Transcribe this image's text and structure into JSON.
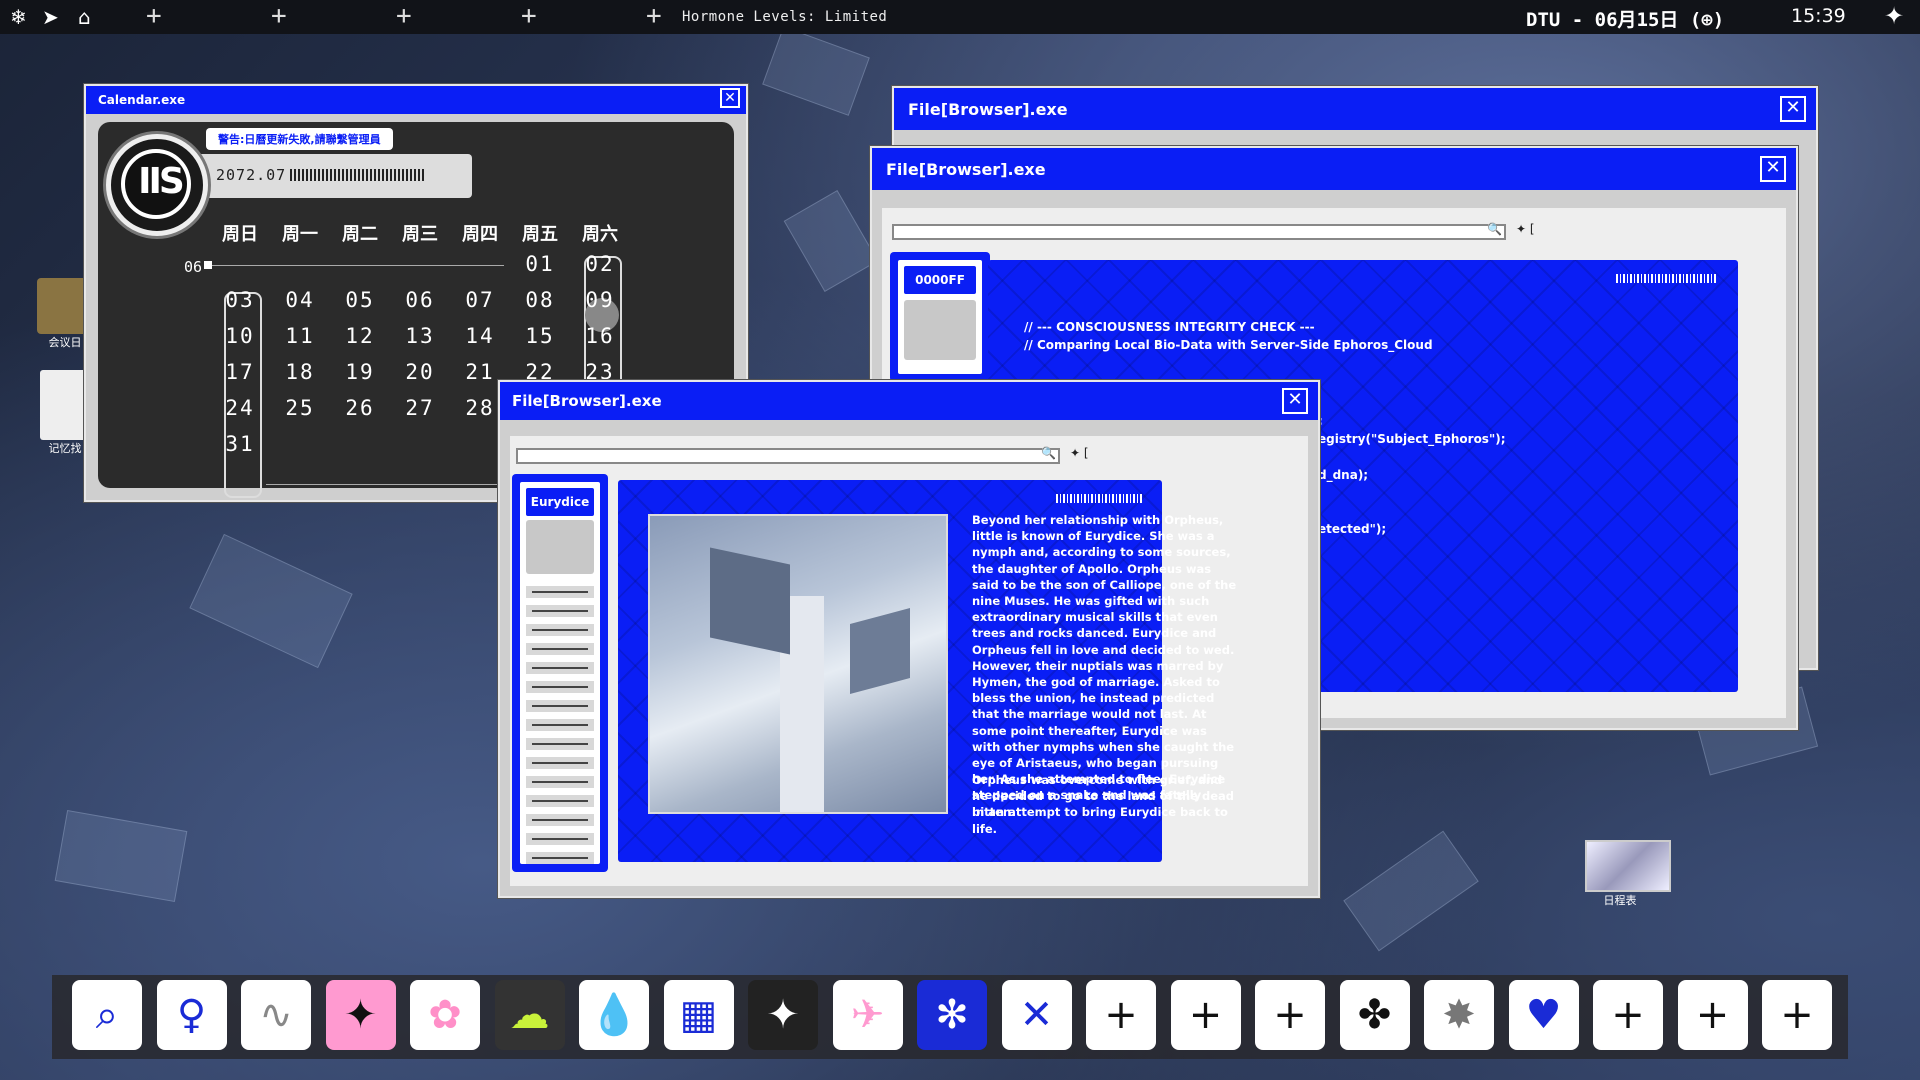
{
  "topbar": {
    "status": "Hormone Levels: Limited",
    "date": "DTU - 06月15日 (⊕)",
    "time": "15:39"
  },
  "calendar": {
    "title": "Calendar.exe",
    "warning": "警告:日曆更新失敗,請聯繫管理員",
    "year_month": "2072.07",
    "month_label": "06",
    "weekdays": [
      "周日",
      "周一",
      "周二",
      "周三",
      "周四",
      "周五",
      "周六"
    ],
    "rows": [
      [
        "",
        "",
        "",
        "",
        "",
        "01",
        "02"
      ],
      [
        "03",
        "04",
        "05",
        "06",
        "07",
        "08",
        "09"
      ],
      [
        "10",
        "11",
        "12",
        "13",
        "14",
        "15",
        "16"
      ],
      [
        "17",
        "18",
        "19",
        "20",
        "21",
        "22",
        "23"
      ],
      [
        "24",
        "25",
        "26",
        "27",
        "28",
        "",
        ""
      ],
      [
        "31",
        "",
        "",
        "",
        "",
        "",
        ""
      ]
    ],
    "selected_day": "09"
  },
  "browser_back": {
    "title": "File[Browser].exe"
  },
  "browser_mid": {
    "title": "File[Browser].exe",
    "sidebar_tag": "0000FF",
    "code_lines": [
      "// --- CONSCIOUSNESS INTEGRITY CHECK ---",
      "// Comparing Local Bio-Data with Server-Side Ephoros_Cloud"
    ],
    "code_fragments": [
      ";",
      "egistry(\"Subject_Ephoros\");",
      "d_dna);",
      "etected\");"
    ]
  },
  "browser_front": {
    "title": "File[Browser].exe",
    "sidebar_tag": "Eurydice",
    "search_extra": "✦ [",
    "text": "Beyond her relationship with Orpheus, little is known of Eurydice. She was a nymph and, according to some sources, the daughter of Apollo. Orpheus was said to be the son of Calliope, one of the nine Muses. He was gifted with such extraordinary musical skills that even trees and rocks danced. Eurydice and Orpheus fell in love and decided to wed. However, their nuptials was marred by Hymen, the god of marriage. Asked to bless the union, he instead predicted that the marriage would not last. At some point thereafter, Eurydice was with other nymphs when she caught the eye of Aristaeus, who began pursuing her. As she attempted to flee, Eurydice stepped on a snake and was fatally bitten.",
    "text2": "Orpheus was overcome with grief, and he decided to go to the land of the dead in an attempt to bring Eurydice back to life."
  },
  "desktop": {
    "icon1": "会议日",
    "icon2": "记忆找",
    "icon3": "日程表"
  },
  "dock": [
    "search-doc-icon",
    "angel-icon",
    "glitch-icon",
    "sparkle-icon",
    "flower-icon",
    "cloud-icon",
    "drop-icon",
    "checker-icon",
    "star-icon",
    "plane-icon",
    "asterisk-icon",
    "cross-icon",
    "plus-icon",
    "plus-icon",
    "plus-icon",
    "clover-icon",
    "burst-icon",
    "heart-icon",
    "plus-icon",
    "plus-icon",
    "plus-icon"
  ]
}
